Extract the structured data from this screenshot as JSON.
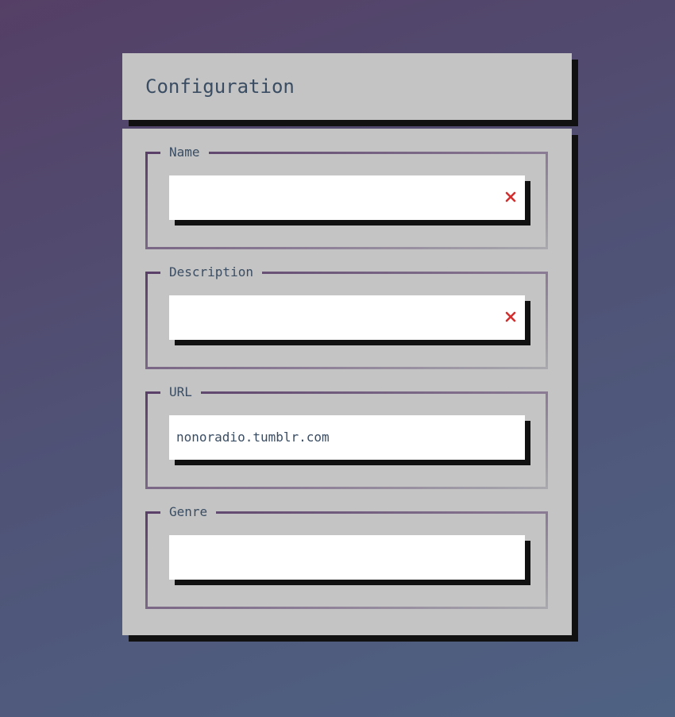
{
  "header": {
    "title": "Configuration"
  },
  "form": {
    "fields": [
      {
        "label": "Name",
        "value": "",
        "has_clear": true
      },
      {
        "label": "Description",
        "value": "",
        "has_clear": true
      },
      {
        "label": "URL",
        "value": "nonoradio.tumblr.com",
        "has_clear": false
      },
      {
        "label": "Genre",
        "value": "",
        "has_clear": false
      }
    ]
  },
  "icons": {
    "clear": "close-icon"
  },
  "colors": {
    "panel": "#c4c4c4",
    "text": "#3a4d63",
    "clear_icon": "#d32f2f",
    "shadow": "#111111"
  }
}
